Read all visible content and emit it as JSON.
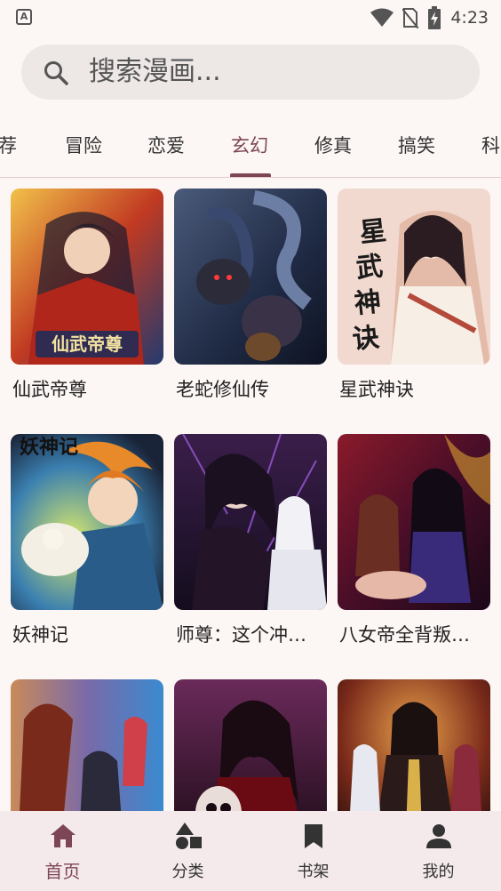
{
  "status": {
    "time": "4:23",
    "badge": "A"
  },
  "search": {
    "placeholder": "搜索漫画..."
  },
  "tabs": [
    "荐",
    "冒险",
    "恋爱",
    "玄幻",
    "修真",
    "搞笑",
    "科"
  ],
  "active_tab": "玄幻",
  "comics": [
    {
      "title": "仙武帝尊",
      "cover_text": "仙武帝尊"
    },
    {
      "title": "老蛇修仙传"
    },
    {
      "title": "星武神诀",
      "cover_text": "星武神诀"
    },
    {
      "title": "妖神记",
      "cover_text": "妖神记"
    },
    {
      "title": "师尊：这个冲…"
    },
    {
      "title": "八女帝全背叛…"
    },
    {
      "title": ""
    },
    {
      "title": ""
    },
    {
      "title": ""
    }
  ],
  "nav": [
    {
      "label": "首页",
      "icon": "home-icon"
    },
    {
      "label": "分类",
      "icon": "category-icon"
    },
    {
      "label": "书架",
      "icon": "bookmark-icon"
    },
    {
      "label": "我的",
      "icon": "person-icon"
    }
  ],
  "colors": {
    "accent": "#7d4656",
    "background": "#fcf6f4",
    "search_bg": "#ede7e6",
    "nav_bg": "#f4eaeb"
  }
}
